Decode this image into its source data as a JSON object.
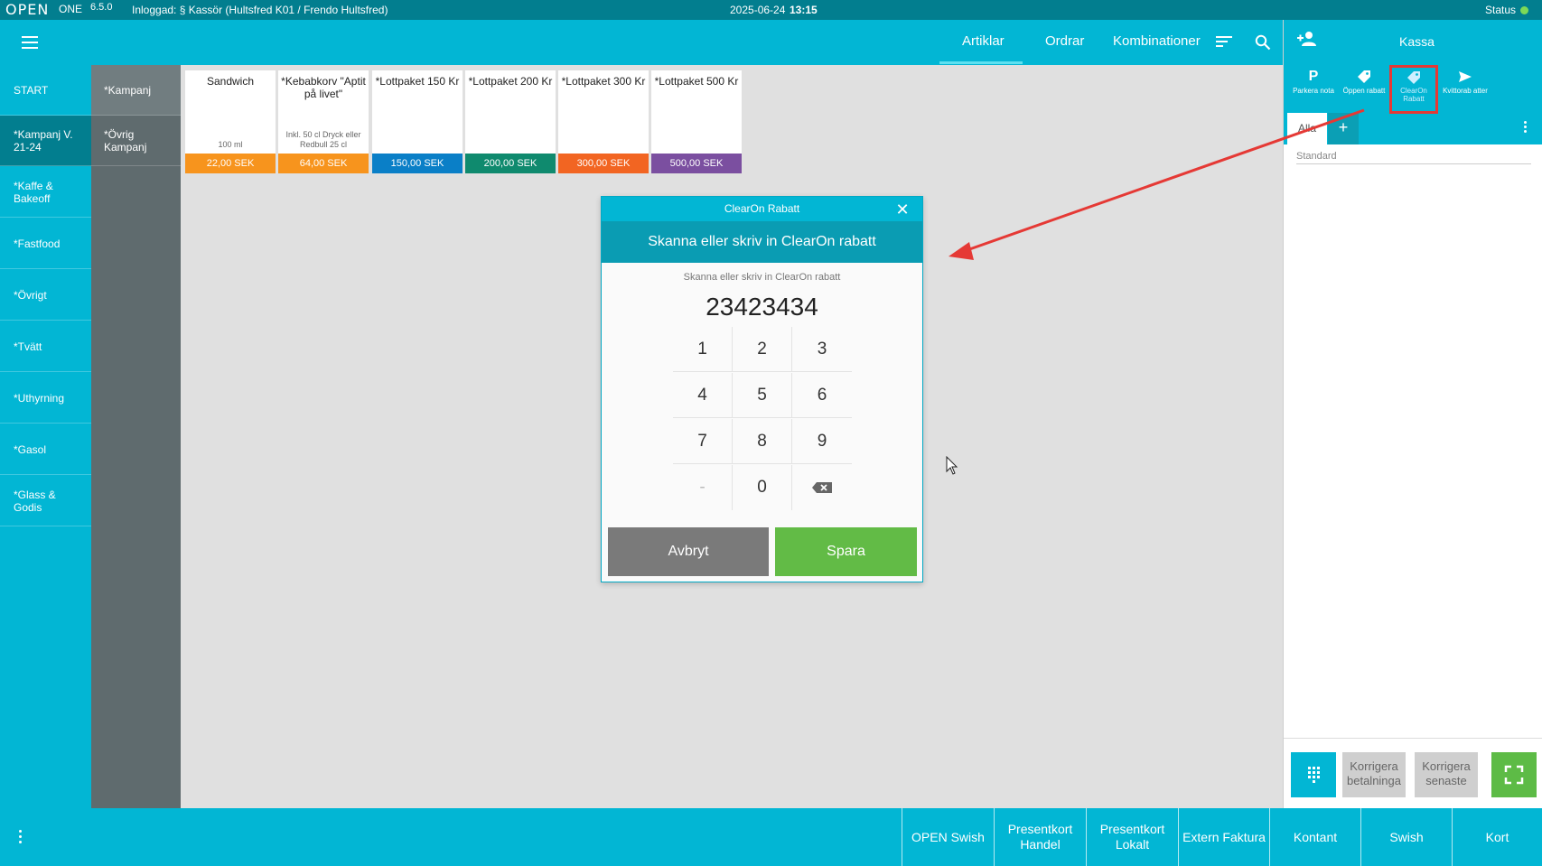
{
  "statusbar": {
    "logo": "OPEN",
    "product": "ONE",
    "version": "6.5.0",
    "login": "Inloggad: § Kassör (Hultsfred K01 / Frendo Hultsfred)",
    "date": "2025-06-24",
    "time": "13:15",
    "status_label": "Status",
    "status_color": "#7ed957"
  },
  "header": {
    "tabs": [
      {
        "label": "Artiklar",
        "active": true
      },
      {
        "label": "Ordrar"
      },
      {
        "label": "Kombinationer"
      }
    ],
    "icons": [
      "menu-icon",
      "sort-icon",
      "search-icon"
    ]
  },
  "categories": [
    {
      "label": "START"
    },
    {
      "label": "*Kampanj V. 21-24",
      "active": true
    },
    {
      "label": "*Kaffe & Bakeoff"
    },
    {
      "label": "*Fastfood"
    },
    {
      "label": "*Övrigt"
    },
    {
      "label": "*Tvätt"
    },
    {
      "label": "*Uthyrning"
    },
    {
      "label": "*Gasol"
    },
    {
      "label": "*Glass & Godis"
    }
  ],
  "subcategories": [
    {
      "label": "*Kampanj",
      "active": true
    },
    {
      "label": "*Övrig Kampanj"
    }
  ],
  "products": [
    {
      "name": "Sandwich",
      "sub": "100 ml",
      "price": "22,00 SEK",
      "color": "#f7941d"
    },
    {
      "name": "*Kebabkorv \"Aptit på livet\"",
      "sub": "Inkl. 50 cl Dryck eller Redbull 25 cl",
      "price": "64,00 SEK",
      "color": "#f7941d"
    },
    {
      "name": "*Lottpaket 150 Kr",
      "sub": "",
      "price": "150,00 SEK",
      "color": "#0a7fc7"
    },
    {
      "name": "*Lottpaket 200 Kr",
      "sub": "",
      "price": "200,00 SEK",
      "color": "#0f8a6e"
    },
    {
      "name": "*Lottpaket 300 Kr",
      "sub": "",
      "price": "300,00 SEK",
      "color": "#f26522"
    },
    {
      "name": "*Lottpaket 500 Kr",
      "sub": "",
      "price": "500,00 SEK",
      "color": "#7b4fa0"
    }
  ],
  "right_panel": {
    "title": "Kassa",
    "actions": [
      {
        "icon": "P",
        "label": "Parkera nota"
      },
      {
        "icon": "tag-icon",
        "label": "Öppen rabatt"
      },
      {
        "icon": "tag-icon",
        "label": "ClearOn Rabatt",
        "highlighted": true
      },
      {
        "icon": "send-icon",
        "label": "Kvittorab atter"
      }
    ],
    "tab_all": "Alla",
    "tab_add": "+",
    "section": "Standard",
    "footer": {
      "correct_payment": "Korrigera betalninga",
      "correct_last": "Korrigera senaste"
    }
  },
  "payments": [
    "OPEN Swish",
    "Presentkort Handel",
    "Presentkort Lokalt",
    "Extern Faktura",
    "Kontant",
    "Swish",
    "Kort"
  ],
  "dialog": {
    "title": "ClearOn Rabatt",
    "heading": "Skanna eller skriv in ClearOn rabatt",
    "hint": "Skanna eller skriv in ClearOn rabatt",
    "value": "23423434",
    "keys": [
      "1",
      "2",
      "3",
      "4",
      "5",
      "6",
      "7",
      "8",
      "9",
      "-",
      "0",
      "backspace-icon"
    ],
    "cancel": "Avbryt",
    "save": "Spara"
  },
  "colors": {
    "primary": "#02b6d4",
    "dark": "#027e8f",
    "accent_green": "#62bb46",
    "highlight_red": "#e53935"
  }
}
